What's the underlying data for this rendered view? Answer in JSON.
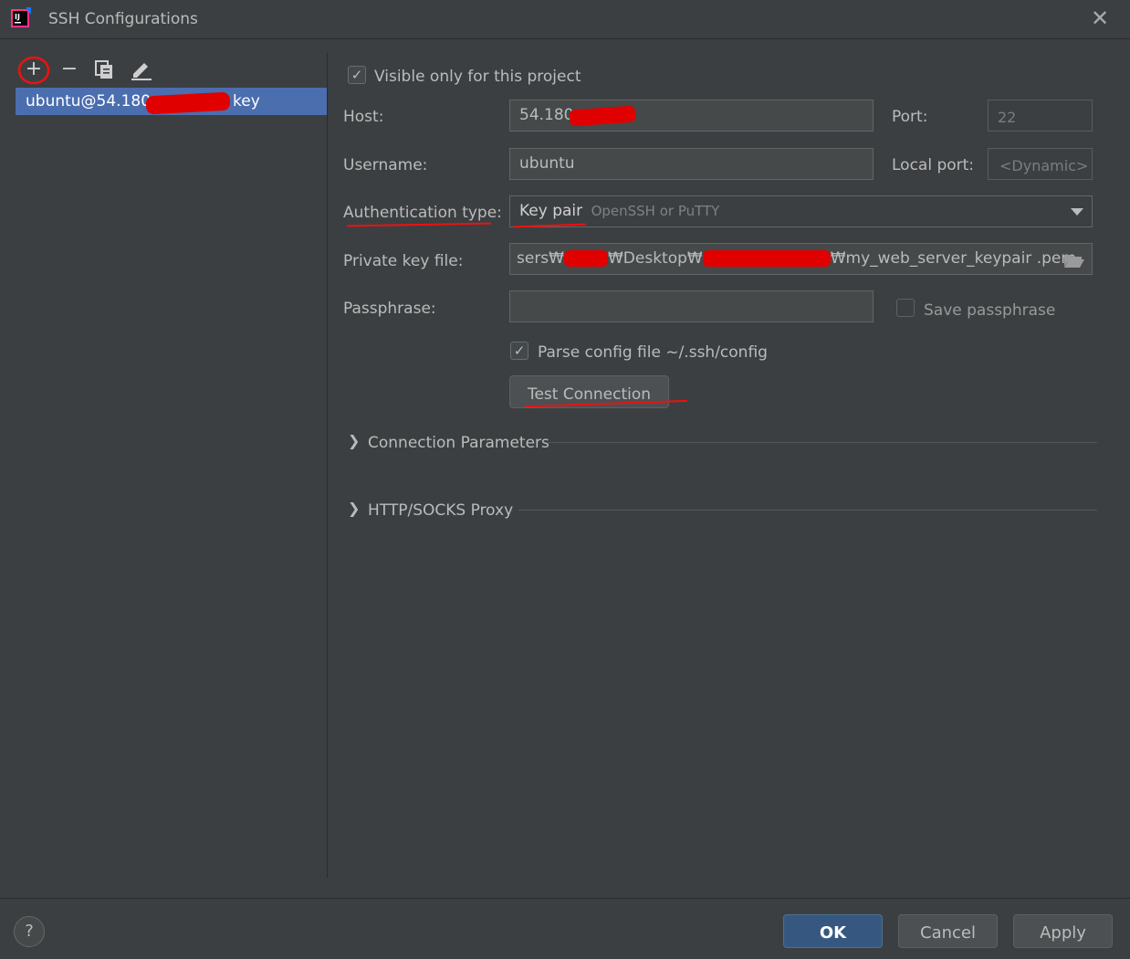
{
  "window": {
    "title": "SSH Configurations"
  },
  "toolbar": {
    "add": "+",
    "remove": "−"
  },
  "list": {
    "item_prefix": "ubuntu@54.180.",
    "item_suffix": "key"
  },
  "form": {
    "visible_only_label": "Visible only for this project",
    "host_label": "Host:",
    "host_value": "54.180.",
    "port_label": "Port:",
    "port_value": "22",
    "username_label": "Username:",
    "username_value": "ubuntu",
    "local_port_label": "Local port:",
    "local_port_value": "<Dynamic>",
    "auth_type_label": "Authentication type:",
    "auth_type_value": "Key pair",
    "auth_type_hint": "OpenSSH or PuTTY",
    "private_key_label": "Private key file:",
    "private_key_prefix": "sers₩",
    "private_key_mid": "₩Desktop₩",
    "private_key_suffix": "₩my_web_server_keypair .pem",
    "passphrase_label": "Passphrase:",
    "save_passphrase_label": "Save passphrase",
    "parse_config_label": "Parse config file ~/.ssh/config",
    "test_connection_label": "Test Connection"
  },
  "sections": {
    "connection_parameters": "Connection Parameters",
    "proxy": "HTTP/SOCKS Proxy"
  },
  "footer": {
    "help": "?",
    "ok": "OK",
    "cancel": "Cancel",
    "apply": "Apply"
  },
  "colors": {
    "background": "#3c3f41",
    "selection": "#4b6eaf",
    "primary_button": "#365880",
    "annotation_red": "#ee1111"
  }
}
